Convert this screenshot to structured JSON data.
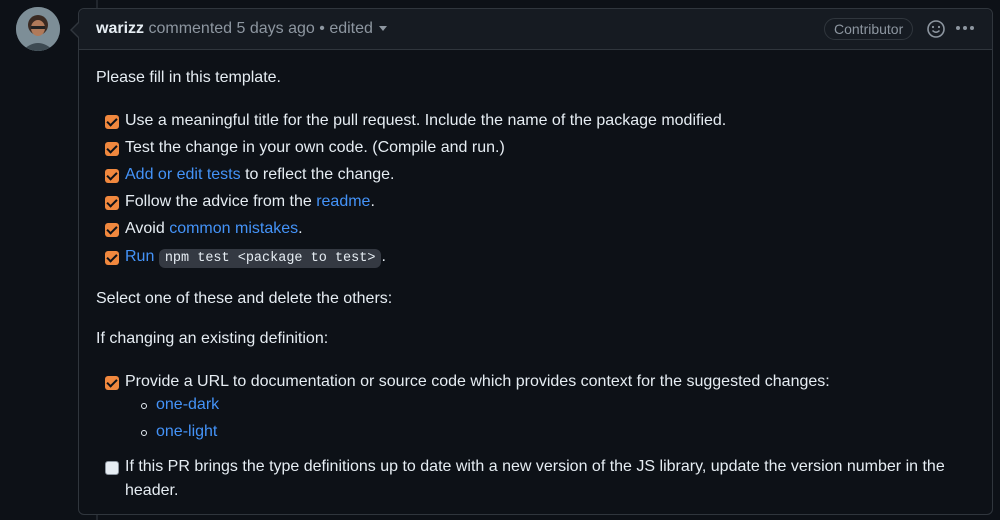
{
  "comment": {
    "author": "warizz",
    "action": "commented",
    "time": "5 days ago",
    "separator": "•",
    "edited": "edited",
    "badge": "Contributor"
  },
  "icons": {
    "avatar": "user-avatar",
    "reaction": "smiley-icon",
    "menu": "kebab-icon",
    "edited_menu": "chevron-down-icon"
  },
  "colors": {
    "checkbox": "#f0883e",
    "link": "#4493f8",
    "background": "#0d1117"
  },
  "body": {
    "intro": "Please fill in this template.",
    "checklist": [
      {
        "checked": true,
        "text": "Use a meaningful title for the pull request. Include the name of the package modified."
      },
      {
        "checked": true,
        "text": "Test the change in your own code. (Compile and run.)"
      },
      {
        "checked": true,
        "link": "Add or edit tests",
        "text": " to reflect the change."
      },
      {
        "checked": true,
        "text": "Follow the advice from the ",
        "link": "readme",
        "after": "."
      },
      {
        "checked": true,
        "text": "Avoid ",
        "link": "common mistakes",
        "after": "."
      },
      {
        "checked": true,
        "link": "Run",
        "code": "npm test <package to test>",
        "after": "."
      }
    ],
    "select_text": "Select one of these and delete the others:",
    "if_changing": "If changing an existing definition:",
    "changing_items": [
      {
        "checked": true,
        "text": "Provide a URL to documentation or source code which provides context for the suggested changes:"
      },
      {
        "checked": false,
        "text": "If this PR brings the type definitions up to date with a new version of the JS library, update the version number in the header."
      }
    ],
    "sub_links": [
      "one-dark",
      "one-light"
    ]
  }
}
